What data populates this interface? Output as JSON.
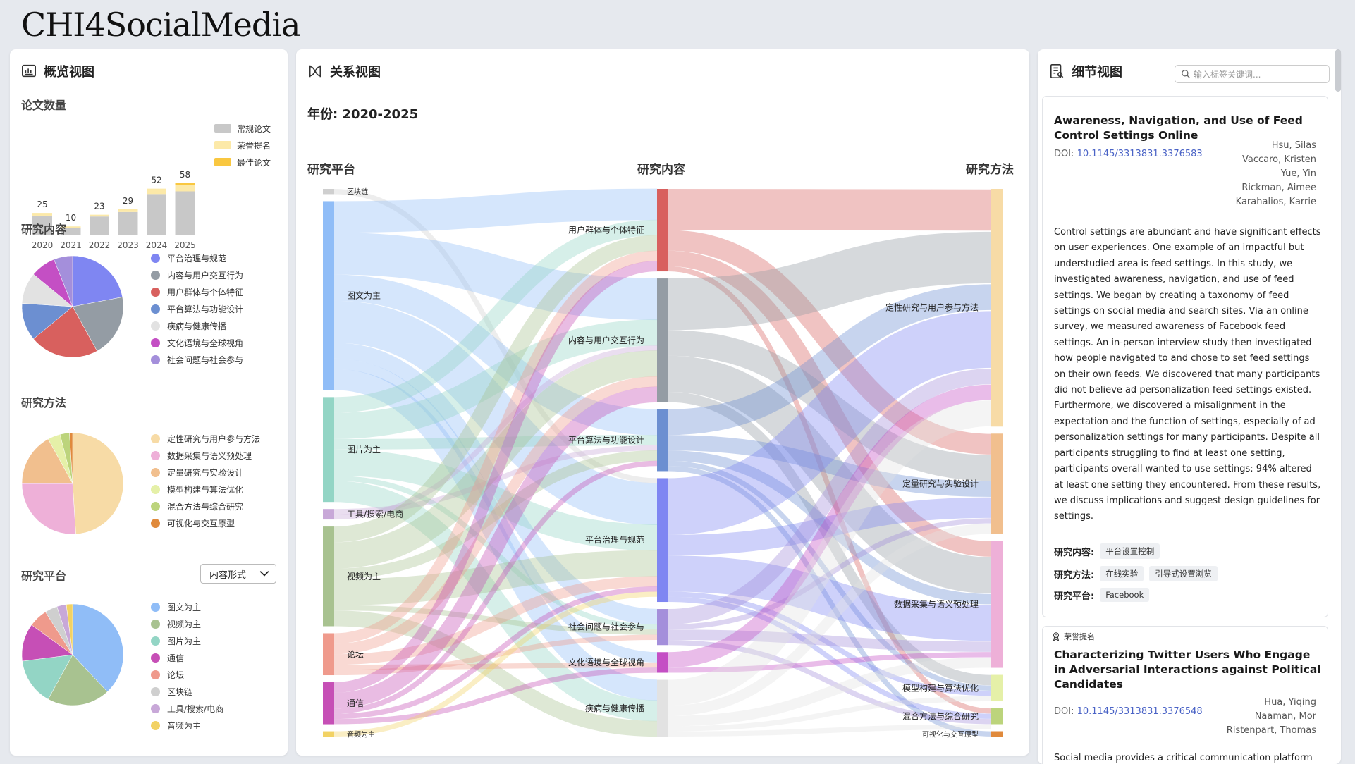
{
  "app": {
    "title": "CHI4SocialMedia"
  },
  "overview": {
    "header": "概览视图",
    "paper_count": {
      "title": "论文数量",
      "legend": [
        "常规论文",
        "荣誉提名",
        "最佳论文"
      ],
      "colors": {
        "regular": "#c8c8c8",
        "honorable": "#fce9a8",
        "best": "#f9c740"
      }
    },
    "content": {
      "title": "研究内容",
      "items": [
        "平台治理与规范",
        "内容与用户交互行为",
        "用户群体与个体特征",
        "平台算法与功能设计",
        "疾病与健康传播",
        "文化语境与全球视角",
        "社会问题与社会参与"
      ],
      "colors": [
        "#7f86f2",
        "#949ca4",
        "#d8605e",
        "#6c8fd1",
        "#e2e2e2",
        "#c44fc4",
        "#a48fdb"
      ]
    },
    "method": {
      "title": "研究方法",
      "items": [
        "定性研究与用户参与方法",
        "数据采集与语义预处理",
        "定量研究与实验设计",
        "模型构建与算法优化",
        "混合方法与综合研究",
        "可视化与交互原型"
      ],
      "colors": [
        "#f7dba6",
        "#eeb0d8",
        "#f1bf8e",
        "#e5f0a8",
        "#bcd47c",
        "#e08a3c"
      ]
    },
    "platform": {
      "title": "研究平台",
      "dropdown": "内容形式",
      "items": [
        "图文为主",
        "视频为主",
        "图片为主",
        "通信",
        "论坛",
        "区块链",
        "工具/搜索/电商",
        "音频为主"
      ],
      "colors": [
        "#90bdf7",
        "#a8c290",
        "#93d5c5",
        "#c64fb6",
        "#ef9a8c",
        "#cfcfcf",
        "#c8a8d8",
        "#f2d264"
      ]
    }
  },
  "chart_data": [
    {
      "type": "bar",
      "title": "论文数量",
      "categories": [
        "2020",
        "2021",
        "2022",
        "2023",
        "2024",
        "2025"
      ],
      "totals": [
        25,
        10,
        23,
        29,
        52,
        58
      ],
      "series": [
        {
          "name": "常规论文",
          "values": [
            22,
            8,
            21,
            26,
            46,
            49
          ]
        },
        {
          "name": "荣誉提名",
          "values": [
            3,
            2,
            2,
            3,
            6,
            7
          ]
        },
        {
          "name": "最佳论文",
          "values": [
            0,
            0,
            0,
            0,
            0,
            2
          ]
        }
      ]
    },
    {
      "type": "pie",
      "title": "研究内容",
      "labels": [
        "平台治理与规范",
        "内容与用户交互行为",
        "用户群体与个体特征",
        "平台算法与功能设计",
        "疾病与健康传播",
        "文化语境与全球视角",
        "社会问题与社会参与"
      ],
      "values": [
        22,
        20,
        22,
        12,
        10,
        8,
        6
      ]
    },
    {
      "type": "pie",
      "title": "研究方法",
      "labels": [
        "定性研究与用户参与方法",
        "数据采集与语义预处理",
        "定量研究与实验设计",
        "模型构建与算法优化",
        "混合方法与综合研究",
        "可视化与交互原型"
      ],
      "values": [
        49,
        26,
        17,
        4,
        3,
        1
      ]
    },
    {
      "type": "pie",
      "title": "研究平台",
      "labels": [
        "图文为主",
        "视频为主",
        "图片为主",
        "通信",
        "论坛",
        "区块链",
        "工具/搜索/电商",
        "音频为主"
      ],
      "values": [
        38,
        20,
        15,
        12,
        6,
        4,
        3,
        2
      ]
    },
    {
      "type": "sankey",
      "columns": [
        "研究平台",
        "研究内容",
        "研究方法"
      ],
      "nodes": {
        "platform": [
          {
            "name": "区块链",
            "value": 1,
            "color": "#cfcfcf"
          },
          {
            "name": "图文为主",
            "value": 36,
            "color": "#90bdf7"
          },
          {
            "name": "图片为主",
            "value": 20,
            "color": "#93d5c5"
          },
          {
            "name": "工具/搜索/电商",
            "value": 2,
            "color": "#c8a8d8"
          },
          {
            "name": "视频为主",
            "value": 19,
            "color": "#a8c290"
          },
          {
            "name": "论坛",
            "value": 8,
            "color": "#ef9a8c"
          },
          {
            "name": "通信",
            "value": 8,
            "color": "#c64fb6"
          },
          {
            "name": "音频为主",
            "value": 1,
            "color": "#f2d264"
          }
        ],
        "content": [
          {
            "name": "用户群体与个体特征",
            "value": 16,
            "color": "#d8605e"
          },
          {
            "name": "内容与用户交互行为",
            "value": 24,
            "color": "#949ca4"
          },
          {
            "name": "平台算法与功能设计",
            "value": 12,
            "color": "#6c8fd1"
          },
          {
            "name": "平台治理与规范",
            "value": 24,
            "color": "#7f86f2"
          },
          {
            "name": "社会问题与社会参与",
            "value": 7,
            "color": "#a48fdb"
          },
          {
            "name": "文化语境与全球视角",
            "value": 4,
            "color": "#c44fc4"
          },
          {
            "name": "疾病与健康传播",
            "value": 11,
            "color": "#e2e2e2"
          }
        ],
        "method": [
          {
            "name": "定性研究与用户参与方法",
            "value": 45,
            "color": "#f7dba6"
          },
          {
            "name": "定量研究与实验设计",
            "value": 19,
            "color": "#f1bf8e"
          },
          {
            "name": "数据采集与语义预处理",
            "value": 24,
            "color": "#eeb0d8"
          },
          {
            "name": "模型构建与算法优化",
            "value": 5,
            "color": "#e5f0a8"
          },
          {
            "name": "混合方法与综合研究",
            "value": 3,
            "color": "#bcd47c"
          },
          {
            "name": "可视化与交互原型",
            "value": 1,
            "color": "#e08a3c"
          }
        ]
      },
      "links_left": [
        [
          "区块链",
          "平台治理与规范",
          1
        ],
        [
          "图文为主",
          "用户群体与个体特征",
          6
        ],
        [
          "图文为主",
          "内容与用户交互行为",
          8
        ],
        [
          "图文为主",
          "平台算法与功能设计",
          5
        ],
        [
          "图文为主",
          "平台治理与规范",
          8
        ],
        [
          "图文为主",
          "社会问题与社会参与",
          3
        ],
        [
          "图文为主",
          "文化语境与全球视角",
          2
        ],
        [
          "图文为主",
          "疾病与健康传播",
          4
        ],
        [
          "图片为主",
          "用户群体与个体特征",
          3
        ],
        [
          "图片为主",
          "内容与用户交互行为",
          5
        ],
        [
          "图片为主",
          "平台算法与功能设计",
          2
        ],
        [
          "图片为主",
          "平台治理与规范",
          5
        ],
        [
          "图片为主",
          "社会问题与社会参与",
          1
        ],
        [
          "图片为主",
          "疾病与健康传播",
          4
        ],
        [
          "工具/搜索/电商",
          "平台算法与功能设计",
          1
        ],
        [
          "工具/搜索/电商",
          "内容与用户交互行为",
          1
        ],
        [
          "视频为主",
          "用户群体与个体特征",
          3
        ],
        [
          "视频为主",
          "内容与用户交互行为",
          5
        ],
        [
          "视频为主",
          "平台算法与功能设计",
          2
        ],
        [
          "视频为主",
          "平台治理与规范",
          5
        ],
        [
          "视频为主",
          "社会问题与社会参与",
          1
        ],
        [
          "视频为主",
          "疾病与健康传播",
          3
        ],
        [
          "论坛",
          "用户群体与个体特征",
          2
        ],
        [
          "论坛",
          "内容与用户交互行为",
          2
        ],
        [
          "论坛",
          "平台治理与规范",
          2
        ],
        [
          "论坛",
          "文化语境与全球视角",
          1
        ],
        [
          "论坛",
          "社会问题与社会参与",
          1
        ],
        [
          "通信",
          "用户群体与个体特征",
          2
        ],
        [
          "通信",
          "内容与用户交互行为",
          3
        ],
        [
          "通信",
          "平台算法与功能设计",
          1
        ],
        [
          "通信",
          "平台治理与规范",
          1
        ],
        [
          "通信",
          "文化语境与全球视角",
          1
        ],
        [
          "音频为主",
          "平台治理与规范",
          1
        ]
      ],
      "links_right": [
        [
          "用户群体与个体特征",
          "定性研究与用户参与方法",
          8
        ],
        [
          "用户群体与个体特征",
          "定量研究与实验设计",
          4
        ],
        [
          "用户群体与个体特征",
          "数据采集与语义预处理",
          3
        ],
        [
          "用户群体与个体特征",
          "混合方法与综合研究",
          1
        ],
        [
          "内容与用户交互行为",
          "定性研究与用户参与方法",
          10
        ],
        [
          "内容与用户交互行为",
          "定量研究与实验设计",
          5
        ],
        [
          "内容与用户交互行为",
          "数据采集与语义预处理",
          7
        ],
        [
          "内容与用户交互行为",
          "模型构建与算法优化",
          2
        ],
        [
          "平台算法与功能设计",
          "定性研究与用户参与方法",
          5
        ],
        [
          "平台算法与功能设计",
          "定量研究与实验设计",
          3
        ],
        [
          "平台算法与功能设计",
          "数据采集与语义预处理",
          2
        ],
        [
          "平台算法与功能设计",
          "模型构建与算法优化",
          1
        ],
        [
          "平台算法与功能设计",
          "可视化与交互原型",
          1
        ],
        [
          "平台治理与规范",
          "定性研究与用户参与方法",
          11
        ],
        [
          "平台治理与规范",
          "定量研究与实验设计",
          4
        ],
        [
          "平台治理与规范",
          "数据采集与语义预处理",
          7
        ],
        [
          "平台治理与规范",
          "模型构建与算法优化",
          1
        ],
        [
          "平台治理与规范",
          "混合方法与综合研究",
          1
        ],
        [
          "社会问题与社会参与",
          "定性研究与用户参与方法",
          3
        ],
        [
          "社会问题与社会参与",
          "定量研究与实验设计",
          1
        ],
        [
          "社会问题与社会参与",
          "数据采集与语义预处理",
          2
        ],
        [
          "社会问题与社会参与",
          "混合方法与综合研究",
          1
        ],
        [
          "文化语境与全球视角",
          "定性研究与用户参与方法",
          3
        ],
        [
          "文化语境与全球视角",
          "数据采集与语义预处理",
          1
        ],
        [
          "疾病与健康传播",
          "定性研究与用户参与方法",
          5
        ],
        [
          "疾病与健康传播",
          "定量研究与实验设计",
          2
        ],
        [
          "疾病与健康传播",
          "数据采集与语义预处理",
          2
        ],
        [
          "疾病与健康传播",
          "模型构建与算法优化",
          1
        ],
        [
          "疾病与健康传播",
          "混合方法与综合研究",
          1
        ]
      ]
    }
  ],
  "relation": {
    "header": "关系视图",
    "year_range": "年份: 2020-2025",
    "col_platform": "研究平台",
    "col_content": "研究内容",
    "col_method": "研究方法"
  },
  "detail": {
    "header": "细节视图",
    "search_placeholder": "输入标签关键词...",
    "papers": [
      {
        "title": "Awareness, Navigation, and Use of Feed Control Settings Online",
        "doi_label": "DOI:",
        "doi": "10.1145/3313831.3376583",
        "authors": [
          "Hsu, Silas",
          "Vaccaro, Kristen",
          "Yue, Yin",
          "Rickman, Aimee",
          "Karahalios, Karrie"
        ],
        "abstract": "Control settings are abundant and have significant effects on user experiences. One example of an impactful but understudied area is feed settings. In this study, we investigated awareness, navigation, and use of feed settings. We began by creating a taxonomy of feed settings on social media and search sites. Via an online survey, we measured awareness of Facebook feed settings. An in-person interview study then investigated how people navigated to and chose to set feed settings on their own feeds. We discovered that many participants did not believe ad personalization feed settings existed. Furthermore, we discovered a misalignment in the expectation and the function of settings, especially of ad personalization settings for many participants. Despite all participants struggling to find at least one setting, participants overall wanted to use settings: 94% altered at least one setting they encountered. From these results, we discuss implications and suggest design guidelines for settings.",
        "content_label": "研究内容:",
        "content_tags": [
          "平台设置控制"
        ],
        "method_label": "研究方法:",
        "method_tags": [
          "在线实验",
          "引导式设置浏览"
        ],
        "platform_label": "研究平台:",
        "platform_tags": [
          "Facebook"
        ]
      },
      {
        "badge": "荣誉提名",
        "title": "Characterizing Twitter Users Who Engage in Adversarial Interactions against Political Candidates",
        "doi_label": "DOI:",
        "doi": "10.1145/3313831.3376548",
        "authors": [
          "Hua, Yiqing",
          "Naaman, Mor",
          "Ristenpart, Thomas"
        ],
        "abstract_start": "Social media provides a critical communication platform for"
      }
    ]
  }
}
